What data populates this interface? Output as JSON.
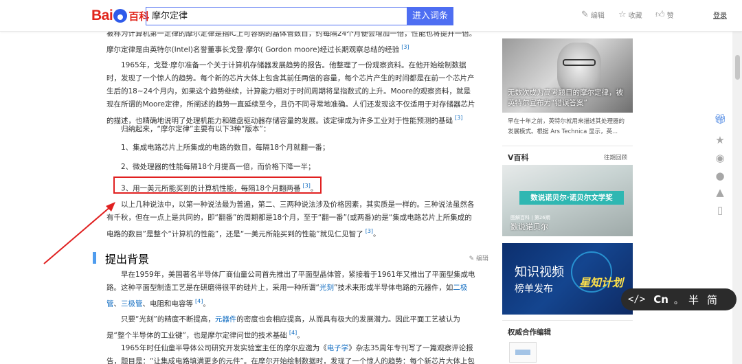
{
  "header": {
    "logo_left": "Bai",
    "logo_right": "du",
    "logo_baike": "百科",
    "search_value": "摩尔定律",
    "enter_button": "进入词条",
    "edit_label": "编辑",
    "favorite_label": "收藏",
    "like_label": "赞",
    "login_label": "登录"
  },
  "main": {
    "p0": "被称为计算机第一定律的摩尔定律是指IC上可容纳的晶体管数目，约每隔24个月便会增加一倍，性能也将提升一倍。摩尔定律是由英特尔(Intel)名誉董事长戈登·摩尔( Gordon moore)经过长期观察总结的经验",
    "p0_cite": "[3]",
    "p1": "1965年，戈登·摩尔准备一个关于计算机存储器发展趋势的报告。他整理了一份观察资料。在他开始绘制数据时，发现了一个惊人的趋势。每个新的芯片大体上包含其前任两倍的容量，每个芯片产生的时间都是在前一个芯片产生后的18~24个月内，如果这个趋势继续，计算能力相对于时间周期将呈指数式的上升。Moore的观察资料，就是现在所谓的Moore定律，所阐述的趋势一直延续至今，且仍不同寻常地准确。人们还发现这不仅适用于对存储器芯片的描述，也精确地说明了处理机能力和磁盘驱动器存储容量的发展。该定律成为许多工业对于性能预测的基础",
    "p1_cite": "[3]",
    "p2": "归纳起来，“摩尔定律”主要有以下3种“版本”：",
    "item1": "1、集成电路芯片上所集成的电路的数目，每隔18个月就翻一番；",
    "item2": "2、微处理器的性能每隔18个月提高一倍，而价格下降一半；",
    "item3": "3、用一美元所能买到的计算机性能，每隔18个月翻两番",
    "item3_cite": "[3]",
    "item3_end": "。",
    "p3": "以上几种说法中，以第一种说法最为普遍，第二、三两种说法涉及价格因素，其实质是一样的。三种说法虽然各有千秋，但在一点上是共同的，即“翻番”的周期都是18个月，至于“翻一番”(或两番)的是“集成电路芯片上所集成的电路的数目”是整个“计算机的性能”，还是“一美元所能买到的性能”就见仁见智了",
    "p3_cite": "[3]",
    "p3_end": "。",
    "section_title": "提出背景",
    "section_edit": "编辑",
    "p4_a": "早在1959年，美国著名半导体厂商仙童公司首先推出了平面型晶体管，紧接着于1961年又推出了平面型集成电路。这种平面型制造工艺是在研磨得很平的硅片上，采用一种所谓“",
    "p4_link1": "光刻",
    "p4_b": "”技术来形成半导体电路的元器件，如",
    "p4_link2": "二极管",
    "p4_c": "、",
    "p4_link3": "三极管",
    "p4_d": "、电阻和电容等",
    "p4_cite": "[4]",
    "p4_end": "。",
    "p5_a": "只要“光刻”的精度不断提高，",
    "p5_link": "元器件",
    "p5_b": "的密度也会相应提高，从而具有极大的发展潜力。因此平面工艺被认为是“整个半导体的工业键”，也是摩尔定律问世的技术基础",
    "p5_cite": "[4]",
    "p5_end": "。",
    "p6_a": "1965年时任仙童半导体公司研究开发实验室主任的摩尔应邀为《",
    "p6_link": "电子学",
    "p6_b": "》杂志35周年专刊写了一篇观察评论报告，题目是：“让集成电路填满更多的元件”。在摩尔开始绘制数据时，发现了一个惊人的趋势：每个新芯片大体上包含其前任两倍的容量"
  },
  "sidebar": {
    "card1_caption": "无数次成为高考题目的摩尔定律，被英特尔宣布为“错误答案”",
    "card1_desc": "早在十年之前，英特尔就用来描述其处理器的发展模式。根据 Ars Technica 显示，英...",
    "vbaike_title": "V百科",
    "vbaike_more": "往期回顾",
    "card2_banner": "数说诺贝尔·诺贝尔文学奖",
    "card2_small": "图解百科 | 第26期",
    "card2_caption": "数说诺贝尔",
    "card3_line1": "知识视频",
    "card3_line2": "榜单发布",
    "card3_badge": "星知计划",
    "auth_title": "权威合作编辑"
  },
  "ime": {
    "code": "</>",
    "cn": "Cn",
    "dot": "。",
    "half": "半",
    "simp": "简"
  },
  "colors": {
    "brand_red": "#e1251b",
    "brand_blue": "#4e6ef2",
    "link_blue": "#136ec2",
    "highlight_red": "#e02020"
  }
}
